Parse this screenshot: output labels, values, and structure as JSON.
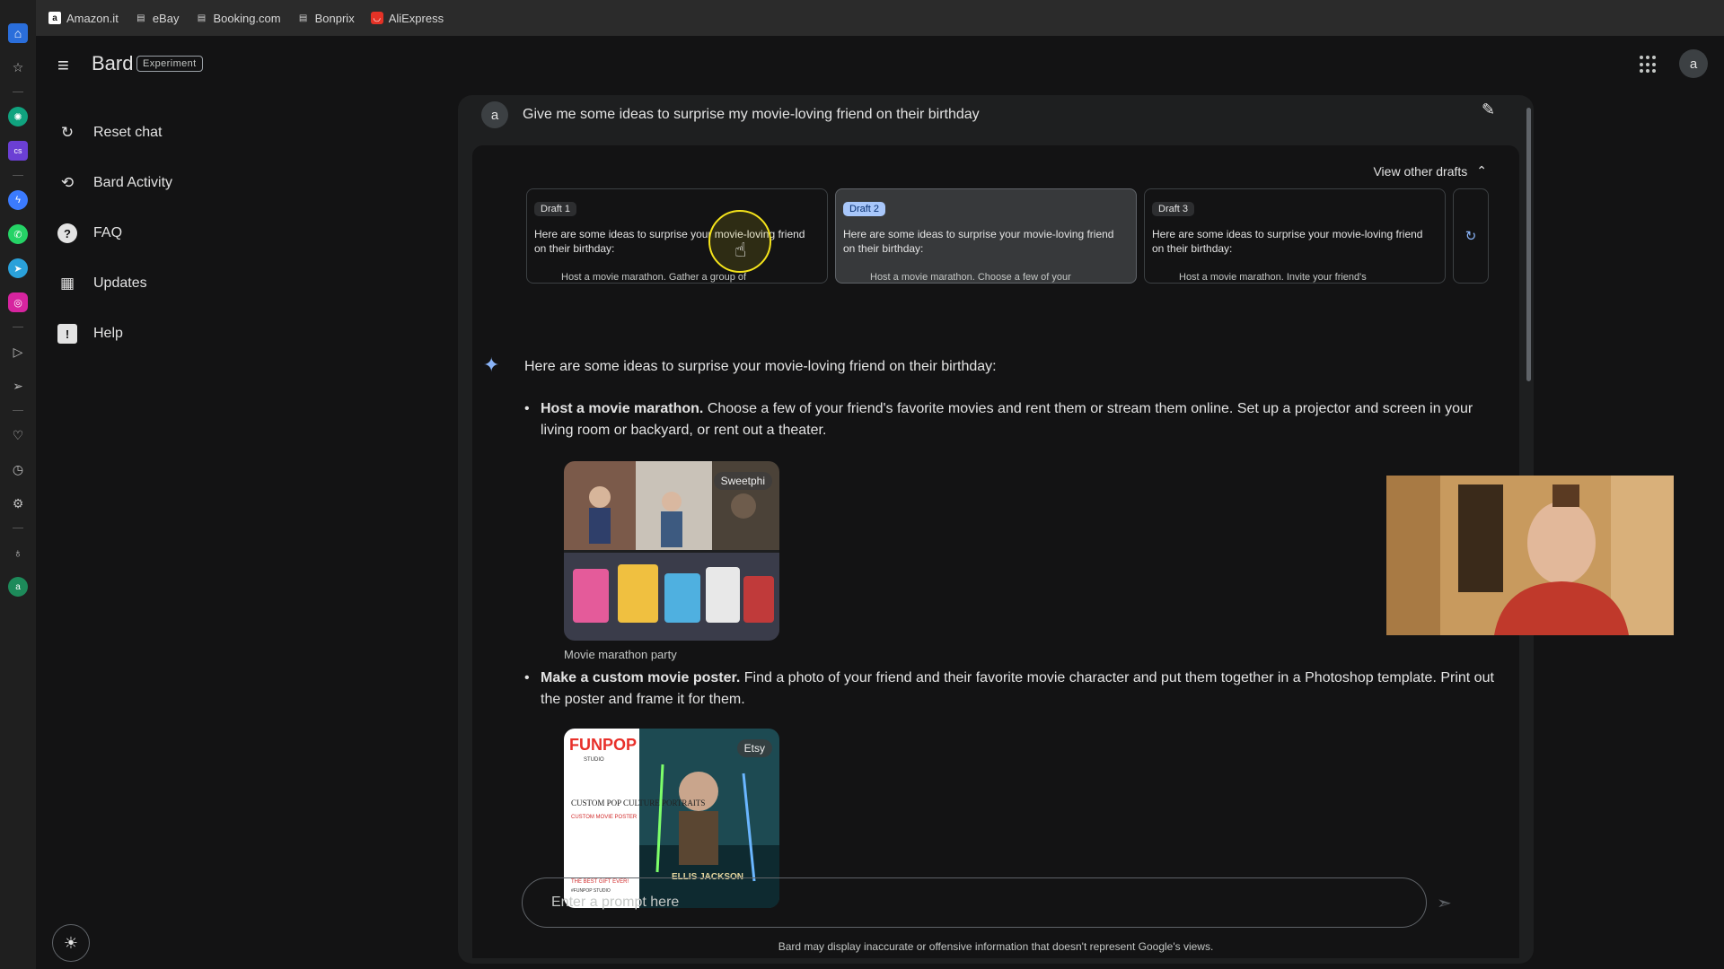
{
  "bookmarks": [
    {
      "label": "Amazon.it",
      "icon": "amazon-icon"
    },
    {
      "label": "eBay",
      "icon": "document-icon"
    },
    {
      "label": "Booking.com",
      "icon": "document-icon"
    },
    {
      "label": "Bonprix",
      "icon": "document-icon"
    },
    {
      "label": "AliExpress",
      "icon": "aliexpress-icon"
    }
  ],
  "header": {
    "title": "Bard",
    "badge": "Experiment",
    "avatar_letter": "a"
  },
  "sidebar": {
    "items": [
      {
        "label": "Reset chat",
        "icon": "reset-icon"
      },
      {
        "label": "Bard Activity",
        "icon": "history-icon"
      },
      {
        "label": "FAQ",
        "icon": "question-icon"
      },
      {
        "label": "Updates",
        "icon": "calendar-icon"
      },
      {
        "label": "Help",
        "icon": "feedback-icon"
      }
    ]
  },
  "conversation": {
    "user_avatar": "a",
    "prompt": "Give me some ideas to surprise my movie-loving friend on their birthday",
    "drafts_toggle": "View other drafts",
    "drafts": [
      {
        "label": "Draft 1",
        "text": "Here are some ideas to surprise your movie-loving friend on their birthday:",
        "more": "Host a movie marathon. Gather a group of"
      },
      {
        "label": "Draft 2",
        "text": "Here are some ideas to surprise your movie-loving friend on their birthday:",
        "more": "Host a movie marathon. Choose a few of your"
      },
      {
        "label": "Draft 3",
        "text": "Here are some ideas to surprise your movie-loving friend on their birthday:",
        "more": "Host a movie marathon. Invite your friend's"
      }
    ],
    "intro": "Here are some ideas to surprise your movie-loving friend on their birthday:",
    "ideas": [
      {
        "title": "Host a movie marathon.",
        "text": " Choose a few of your friend's favorite movies and rent them or stream them online. Set up a projector and screen in your living room or backyard, or rent out a theater.",
        "image_source": "Sweetphi",
        "caption": "Movie marathon party"
      },
      {
        "title": "Make a custom movie poster.",
        "text": " Find a photo of your friend and their favorite movie character and put them together in a Photoshop template. Print out the poster and frame it for them.",
        "image_source": "Etsy",
        "caption": ""
      }
    ],
    "poster_text": {
      "brand": "FUNPOP",
      "studio": "STUDIO",
      "headline": "CUSTOM POP CULTURE PORTRAITS",
      "sub": "CUSTOM MOVIE POSTER",
      "gift": "THE BEST GIFT EVER!",
      "tag": "#FUNPOP STUDIO",
      "name": "ELLIS JACKSON"
    }
  },
  "input": {
    "placeholder": "Enter a prompt here"
  },
  "disclaimer": "Bard may display inaccurate or offensive information that doesn't represent Google's views.",
  "colors": {
    "background": "#131314",
    "accent": "#8ab4f8",
    "draft_selected_chip": "#a8c7fa"
  }
}
